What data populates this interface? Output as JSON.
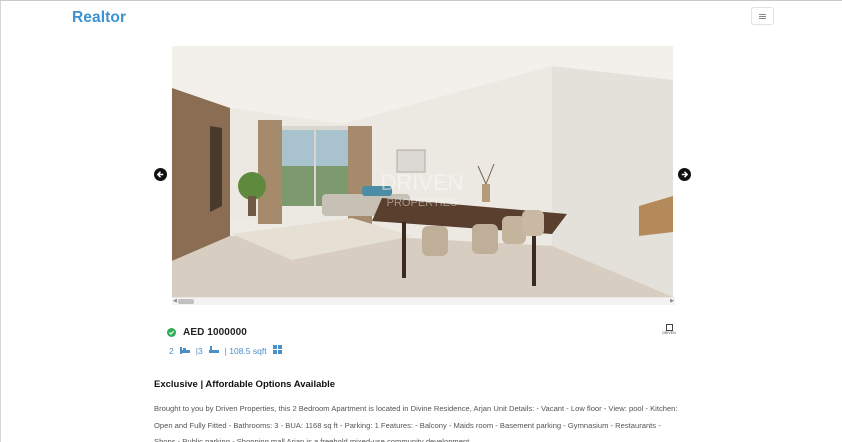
{
  "header": {
    "brand": "Realtor",
    "menu_icon": "hamburger-icon"
  },
  "gallery": {
    "photo_description": "Apartment living and dining room",
    "watermark_line1": "DRIVEN",
    "watermark_line2": "PROPERTIES",
    "prev_icon": "arrow-left-icon",
    "next_icon": "arrow-right-icon"
  },
  "listing": {
    "price": "AED 1000000",
    "verified_icon": "check-circle-icon",
    "bedrooms": "2",
    "bathrooms": "|3",
    "area": "| 108.5 sqft",
    "agency_logo_text": "DRIVEN",
    "title": "Exclusive | Affordable Options Available",
    "description": "Brought to you by Driven Properties, this 2 Bedroom Apartment is located in Divine Residence, Arjan Unit Details: - Vacant - Low floor - View: pool - Kitchen: Open and Fully Fitted - Bathrooms: 3 - BUA: 1168 sq ft - Parking: 1 Features: - Balcony - Maids room - Basement parking - Gymnasium - Restaurants - Shops - Public parking - Shopping mall Arjan is a freehold mixed-use community development"
  },
  "colors": {
    "brand": "#3b93d2",
    "verified": "#2eac57",
    "stats": "#4b8fc8"
  }
}
